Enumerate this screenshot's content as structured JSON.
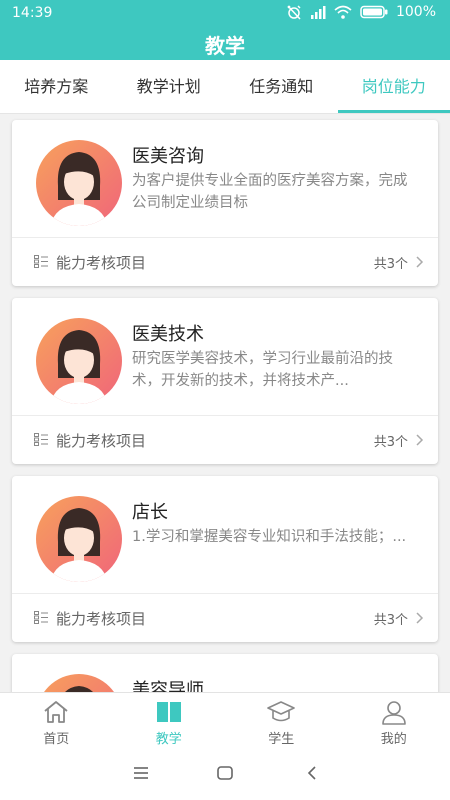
{
  "status": {
    "time": "14:39",
    "battery": "100%"
  },
  "header": {
    "title": "教学"
  },
  "tabs": [
    {
      "label": "培养方案",
      "active": false
    },
    {
      "label": "教学计划",
      "active": false
    },
    {
      "label": "任务通知",
      "active": false
    },
    {
      "label": "岗位能力",
      "active": true
    }
  ],
  "cards": [
    {
      "title": "医美咨询",
      "desc": "为客户提供专业全面的医疗美容方案，完成公司制定业绩目标",
      "footer_label": "能力考核项目",
      "count": "共3个"
    },
    {
      "title": "医美技术",
      "desc": "研究医学美容技术，学习行业最前沿的技术，开发新的技术，并将技术产...",
      "footer_label": "能力考核项目",
      "count": "共3个"
    },
    {
      "title": "店长",
      "desc": "1.学习和掌握美容专业知识和手法技能；...",
      "footer_label": "能力考核项目",
      "count": "共3个"
    },
    {
      "title": "美容导师",
      "desc": "",
      "footer_label": "",
      "count": ""
    }
  ],
  "bottom_nav": [
    {
      "label": "首页",
      "icon": "home-icon",
      "active": false
    },
    {
      "label": "教学",
      "icon": "book-icon",
      "active": true
    },
    {
      "label": "学生",
      "icon": "graduation-cap-icon",
      "active": false
    },
    {
      "label": "我的",
      "icon": "user-icon",
      "active": false
    }
  ],
  "colors": {
    "accent": "#3ec8c0",
    "avatar_gradient_start": "#f7a15c",
    "avatar_gradient_end": "#f0657a"
  }
}
